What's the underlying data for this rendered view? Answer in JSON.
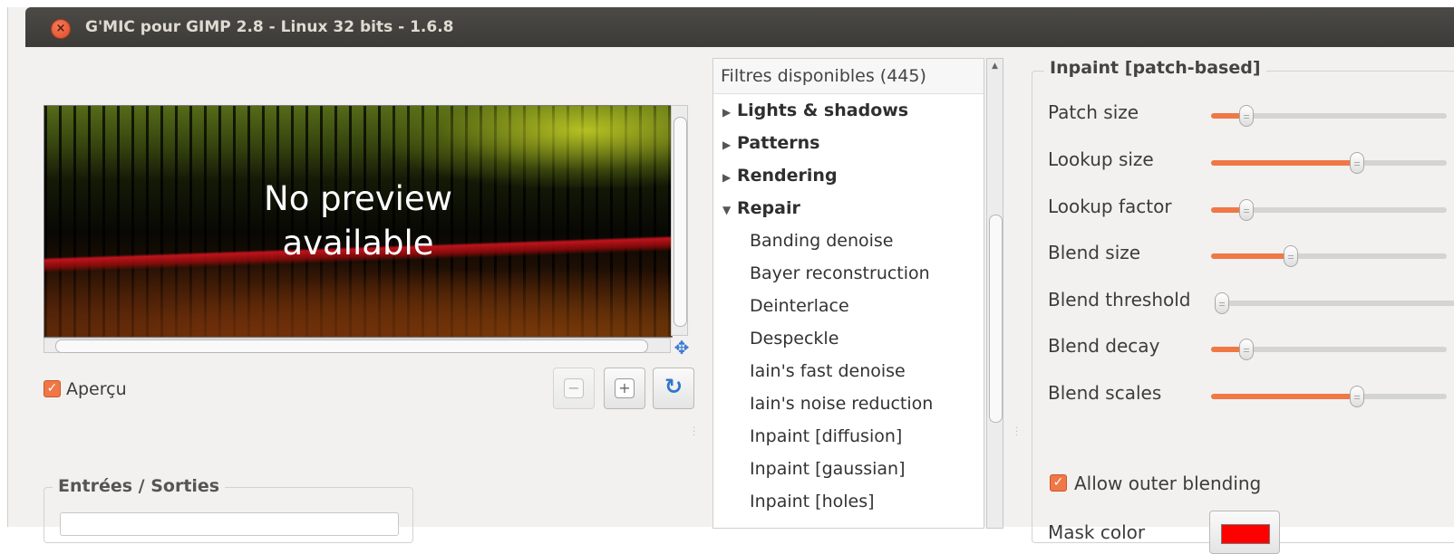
{
  "window": {
    "title": "G'MIC pour GIMP 2.8 - Linux 32 bits - 1.6.8",
    "close_glyph": "×"
  },
  "preview": {
    "message_line1": "No preview",
    "message_line2": "available",
    "checkbox_label": "Aperçu",
    "checked": true
  },
  "zoom_buttons": [
    {
      "name": "zoom-out",
      "glyph": "−",
      "enabled": false
    },
    {
      "name": "zoom-in",
      "glyph": "+",
      "enabled": true
    },
    {
      "name": "refresh",
      "glyph": "↻",
      "enabled": true
    }
  ],
  "io": {
    "title": "Entrées / Sorties"
  },
  "filters": {
    "header": "Filtres disponibles (445)",
    "items": [
      {
        "label": "Lights & shadows",
        "type": "category",
        "expanded": false
      },
      {
        "label": "Patterns",
        "type": "category",
        "expanded": false
      },
      {
        "label": "Rendering",
        "type": "category",
        "expanded": false
      },
      {
        "label": "Repair",
        "type": "category",
        "expanded": true
      },
      {
        "label": "Banding denoise",
        "type": "filter"
      },
      {
        "label": "Bayer reconstruction",
        "type": "filter"
      },
      {
        "label": "Deinterlace",
        "type": "filter"
      },
      {
        "label": "Despeckle",
        "type": "filter"
      },
      {
        "label": "Iain's fast denoise",
        "type": "filter"
      },
      {
        "label": "Iain's noise reduction",
        "type": "filter"
      },
      {
        "label": "Inpaint [diffusion]",
        "type": "filter"
      },
      {
        "label": "Inpaint [gaussian]",
        "type": "filter"
      },
      {
        "label": "Inpaint [holes]",
        "type": "filter"
      }
    ]
  },
  "params": {
    "title": "Inpaint [patch-based]",
    "sliders": [
      {
        "label": "Patch size",
        "value": 0.15
      },
      {
        "label": "Lookup size",
        "value": 0.62
      },
      {
        "label": "Lookup factor",
        "value": 0.15
      },
      {
        "label": "Blend size",
        "value": 0.34
      },
      {
        "label": "Blend threshold",
        "value": 0.0
      },
      {
        "label": "Blend decay",
        "value": 0.15
      },
      {
        "label": "Blend scales",
        "value": 0.62
      }
    ],
    "allow_outer_blending": {
      "label": "Allow outer blending",
      "checked": true
    },
    "mask_color": {
      "label": "Mask color",
      "value": "#ff0000"
    }
  },
  "colors": {
    "accent": "#f07746",
    "titlebar": "#3c3b37",
    "close": "#df4a25"
  }
}
